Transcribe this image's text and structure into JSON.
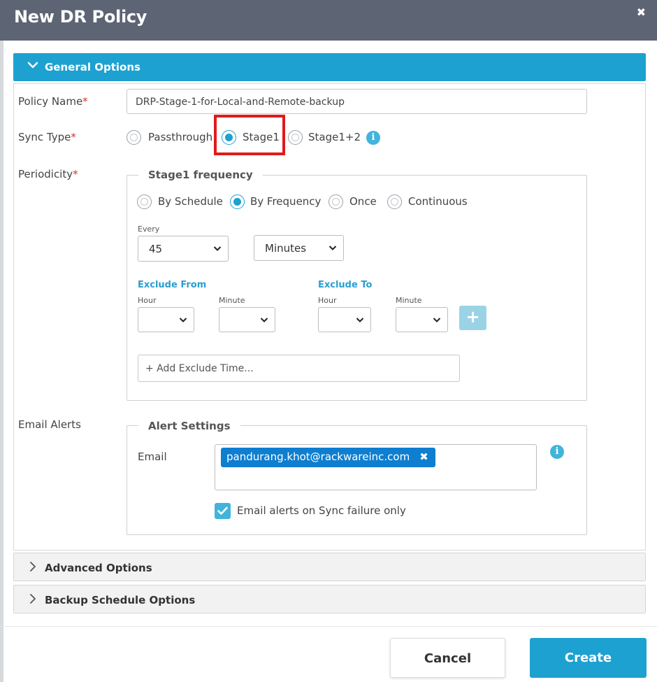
{
  "dialog": {
    "title": "New DR Policy",
    "close_label": "✖"
  },
  "sections": {
    "general": "General Options",
    "advanced": "Advanced Options",
    "backup": "Backup Schedule Options"
  },
  "form": {
    "policy_name_label": "Policy Name",
    "policy_name_value": "DRP-Stage-1-for-Local-and-Remote-backup",
    "sync_type_label": "Sync Type",
    "sync_options": [
      "Passthrough",
      "Stage1",
      "Stage1+2"
    ],
    "sync_selected": "Stage1",
    "periodicity_label": "Periodicity",
    "required_mark": "*",
    "email_alerts_label": "Email Alerts"
  },
  "frequency": {
    "legend": "Stage1 frequency",
    "modes": [
      "By Schedule",
      "By Frequency",
      "Once",
      "Continuous"
    ],
    "selected_mode": "By Frequency",
    "every_label": "Every",
    "every_value": "45",
    "unit_value": "Minutes",
    "exclude_from_label": "Exclude From",
    "exclude_to_label": "Exclude To",
    "hour_label": "Hour",
    "minute_label": "Minute",
    "add_exclude_placeholder": "+ Add Exclude Time...",
    "plus_label": "+"
  },
  "alerts": {
    "legend": "Alert Settings",
    "email_label": "Email",
    "email_tag": "pandurang.khot@rackwareinc.com",
    "tag_remove": "✖",
    "checkbox_label": "Email alerts on Sync failure only",
    "checkbox_checked": true
  },
  "footer": {
    "cancel_label": "Cancel",
    "create_label": "Create"
  },
  "info_icon_glyph": "i",
  "colors": {
    "header_bg": "#5d6574",
    "accent": "#1da1d0",
    "tag_bg": "#0e7ed0",
    "highlight": "#e01b1b",
    "required": "#d9302c"
  }
}
